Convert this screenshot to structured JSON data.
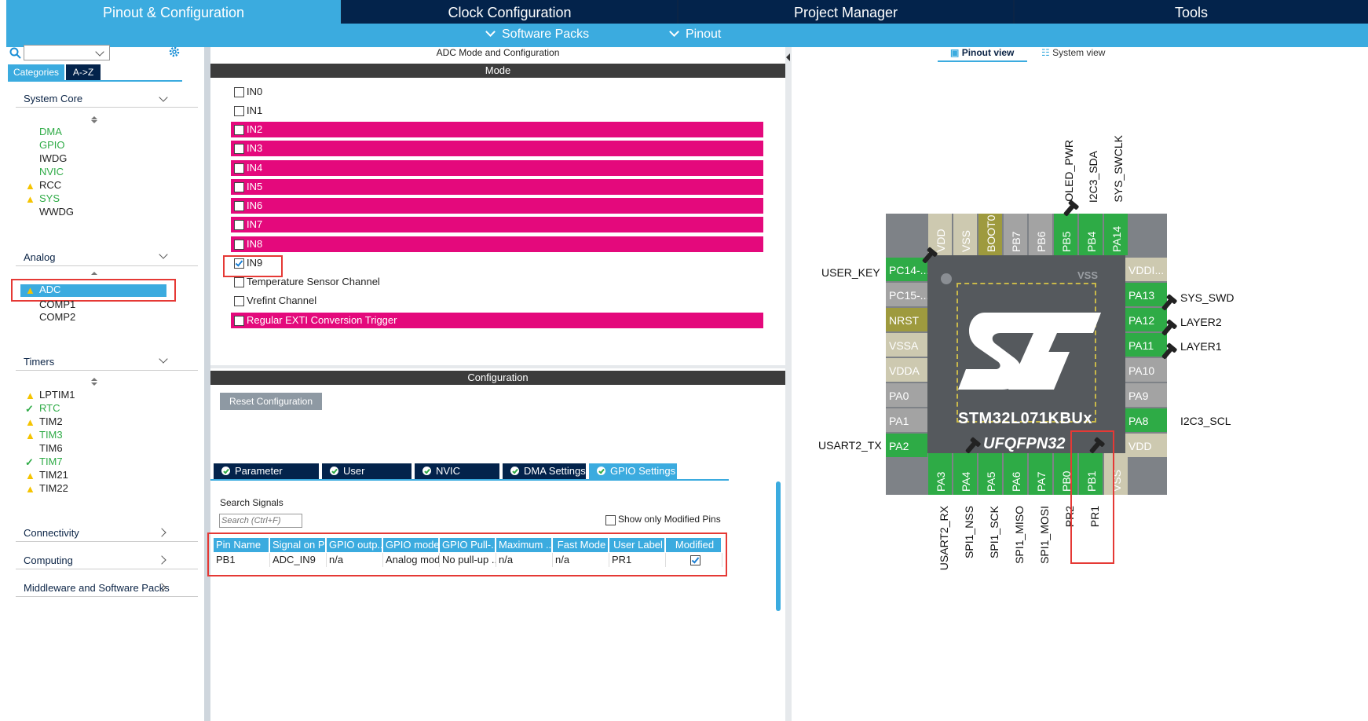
{
  "tabs": [
    "Pinout & Configuration",
    "Clock Configuration",
    "Project Manager",
    "Tools"
  ],
  "subtabs": [
    "Software Packs",
    "Pinout"
  ],
  "left": {
    "categories_tab": "Categories",
    "az_tab": "A->Z",
    "system_core": {
      "title": "System Core",
      "items": [
        "DMA",
        "GPIO",
        "IWDG",
        "NVIC",
        "RCC",
        "SYS",
        "WWDG"
      ]
    },
    "analog": {
      "title": "Analog",
      "items": [
        "ADC",
        "COMP1",
        "COMP2"
      ]
    },
    "timers": {
      "title": "Timers",
      "items": [
        "LPTIM1",
        "RTC",
        "TIM2",
        "TIM3",
        "TIM6",
        "TIM7",
        "TIM21",
        "TIM22"
      ]
    },
    "connectivity": "Connectivity",
    "computing": "Computing",
    "middleware": "Middleware and Software Packs"
  },
  "mode": {
    "title": "ADC Mode and Configuration",
    "header": "Mode",
    "channels": [
      "IN0",
      "IN1",
      "IN2",
      "IN3",
      "IN4",
      "IN5",
      "IN6",
      "IN7",
      "IN8",
      "IN9",
      "Temperature Sensor Channel",
      "Vrefint Channel",
      "Regular EXTI Conversion Trigger"
    ]
  },
  "config": {
    "header": "Configuration",
    "reset": "Reset Configuration",
    "tabs": [
      "Parameter Settings",
      "User Constants",
      "NVIC Settings",
      "DMA Settings",
      "GPIO Settings"
    ],
    "search_label": "Search Signals",
    "search_placeholder": "Search (Ctrl+F)",
    "show_modified": "Show only Modified Pins",
    "columns": [
      "Pin Name",
      "Signal on Pin",
      "GPIO outp...",
      "GPIO mode",
      "GPIO Pull-...",
      "Maximum ...",
      "Fast Mode",
      "User Label",
      "Modified"
    ],
    "row": [
      "PB1",
      "ADC_IN9",
      "n/a",
      "Analog mode",
      "No pull-up ...",
      "n/a",
      "n/a",
      "PR1",
      ""
    ]
  },
  "view": {
    "pinout_view": "Pinout view",
    "system_view": "System view",
    "chip_name": "STM32L071KBUx",
    "package": "UFQFPN32",
    "vss_label": "VSS"
  },
  "pins": {
    "top": [
      "VDD",
      "VSS",
      "BOOT0",
      "PB7",
      "PB6",
      "PB5",
      "PB4",
      "PA14"
    ],
    "left": [
      "PC14-...",
      "PC15-...",
      "NRST",
      "VSSA",
      "VDDA",
      "PA0",
      "PA1",
      "PA2"
    ],
    "right": [
      "VDDI...",
      "PA13",
      "PA12",
      "PA11",
      "PA10",
      "PA9",
      "PA8",
      "VDD"
    ],
    "bottom": [
      "PA3",
      "PA4",
      "PA5",
      "PA6",
      "PA7",
      "PB0",
      "PB1",
      "VSS"
    ]
  },
  "labels": {
    "top": [
      "OLED_PWR",
      "I2C3_SDA",
      "SYS_SWCLK"
    ],
    "left": [
      "USER_KEY",
      "USART2_TX"
    ],
    "right": [
      "SYS_SWD",
      "LAYER2",
      "LAYER1",
      "I2C3_SCL"
    ],
    "bottom": [
      "USART2_RX",
      "SPI1_NSS",
      "SPI1_SCK",
      "SPI1_MISO",
      "SPI1_MOSI",
      "PR2",
      "PR1"
    ]
  },
  "colors": {
    "accent": "#3babdf",
    "navy": "#03234b",
    "magenta": "#e4097c",
    "green": "#2eab46",
    "highlight": "#e53935"
  }
}
